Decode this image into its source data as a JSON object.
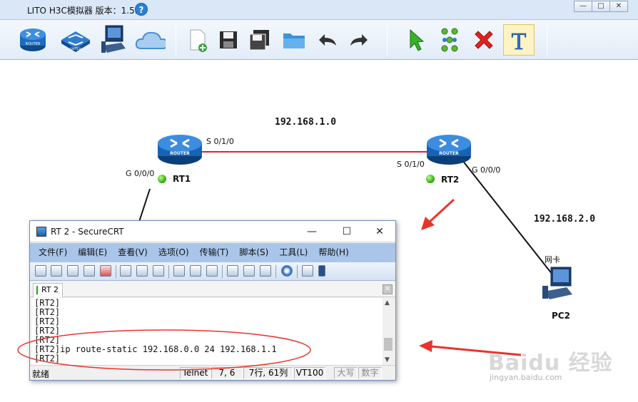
{
  "app": {
    "title": "LITO H3C模拟器 版本：1.5.2",
    "help_label": "?",
    "window_buttons": [
      "—",
      "□",
      "✕"
    ]
  },
  "toolbar": {
    "items": [
      {
        "name": "router-tool",
        "icon": "router-icon",
        "caption": "ROUTER"
      },
      {
        "name": "switch-tool",
        "icon": "switch-icon",
        "caption": "SWITCH"
      },
      {
        "name": "pc-tool",
        "icon": "pc-icon"
      },
      {
        "name": "cloud-tool",
        "icon": "cloud-icon"
      },
      {
        "name": "new-file-tool",
        "icon": "new-file-icon"
      },
      {
        "name": "save-tool",
        "icon": "save-icon"
      },
      {
        "name": "save-as-tool",
        "icon": "save-as-icon"
      },
      {
        "name": "open-folder-tool",
        "icon": "folder-icon"
      },
      {
        "name": "undo-tool",
        "icon": "undo-icon"
      },
      {
        "name": "redo-tool",
        "icon": "redo-icon"
      },
      {
        "name": "select-tool",
        "icon": "cursor-icon"
      },
      {
        "name": "connect-tool",
        "icon": "connect-icon"
      },
      {
        "name": "delete-tool",
        "icon": "delete-icon"
      },
      {
        "name": "text-tool",
        "icon": "text-icon",
        "selected": true,
        "caption": "T"
      }
    ]
  },
  "topology": {
    "networks": [
      "192.168.1.0",
      "192.168.2.0"
    ],
    "nodes": [
      {
        "id": "RT1",
        "label": "RT1",
        "type": "router",
        "caption": "ROUTER"
      },
      {
        "id": "RT2",
        "label": "RT2",
        "type": "router",
        "caption": "ROUTER"
      },
      {
        "id": "PC2",
        "label": "PC2",
        "type": "pc"
      }
    ],
    "interfaces": {
      "rt1_g": "G 0/0/0",
      "rt1_s": "S 0/1/0",
      "rt2_s": "S 0/1/0",
      "rt2_g": "G 0/0/0",
      "pc2_nic": "网卡"
    },
    "colors": {
      "serial_link": "#d9262c",
      "eth_link": "#111111",
      "led": "#27a300",
      "annotation": "#e8342c"
    }
  },
  "securecrt": {
    "title": "RT 2 - SecureCRT",
    "controls": [
      "—",
      "☐",
      "✕"
    ],
    "menu": [
      "文件(F)",
      "编辑(E)",
      "查看(V)",
      "选项(O)",
      "传输(T)",
      "脚本(S)",
      "工具(L)",
      "帮助(H)"
    ],
    "tab": "RT 2",
    "tab_close": "✕",
    "terminal_lines": [
      "[RT2]",
      "[RT2]",
      "[RT2]",
      "[RT2]",
      "[RT2]",
      "[RT2]ip route-static 192.168.0.0 24 192.168.1.1",
      "[RT2]"
    ],
    "status": {
      "ready": "就绪",
      "protocol": "Telnet",
      "cursor": "7,  6",
      "rows_cols": "7行, 61列",
      "terminal": "VT100",
      "caps": "大写",
      "num": "数字"
    }
  },
  "watermark": {
    "main": "Baidu 经验",
    "url": "jingyan.baidu.com"
  }
}
